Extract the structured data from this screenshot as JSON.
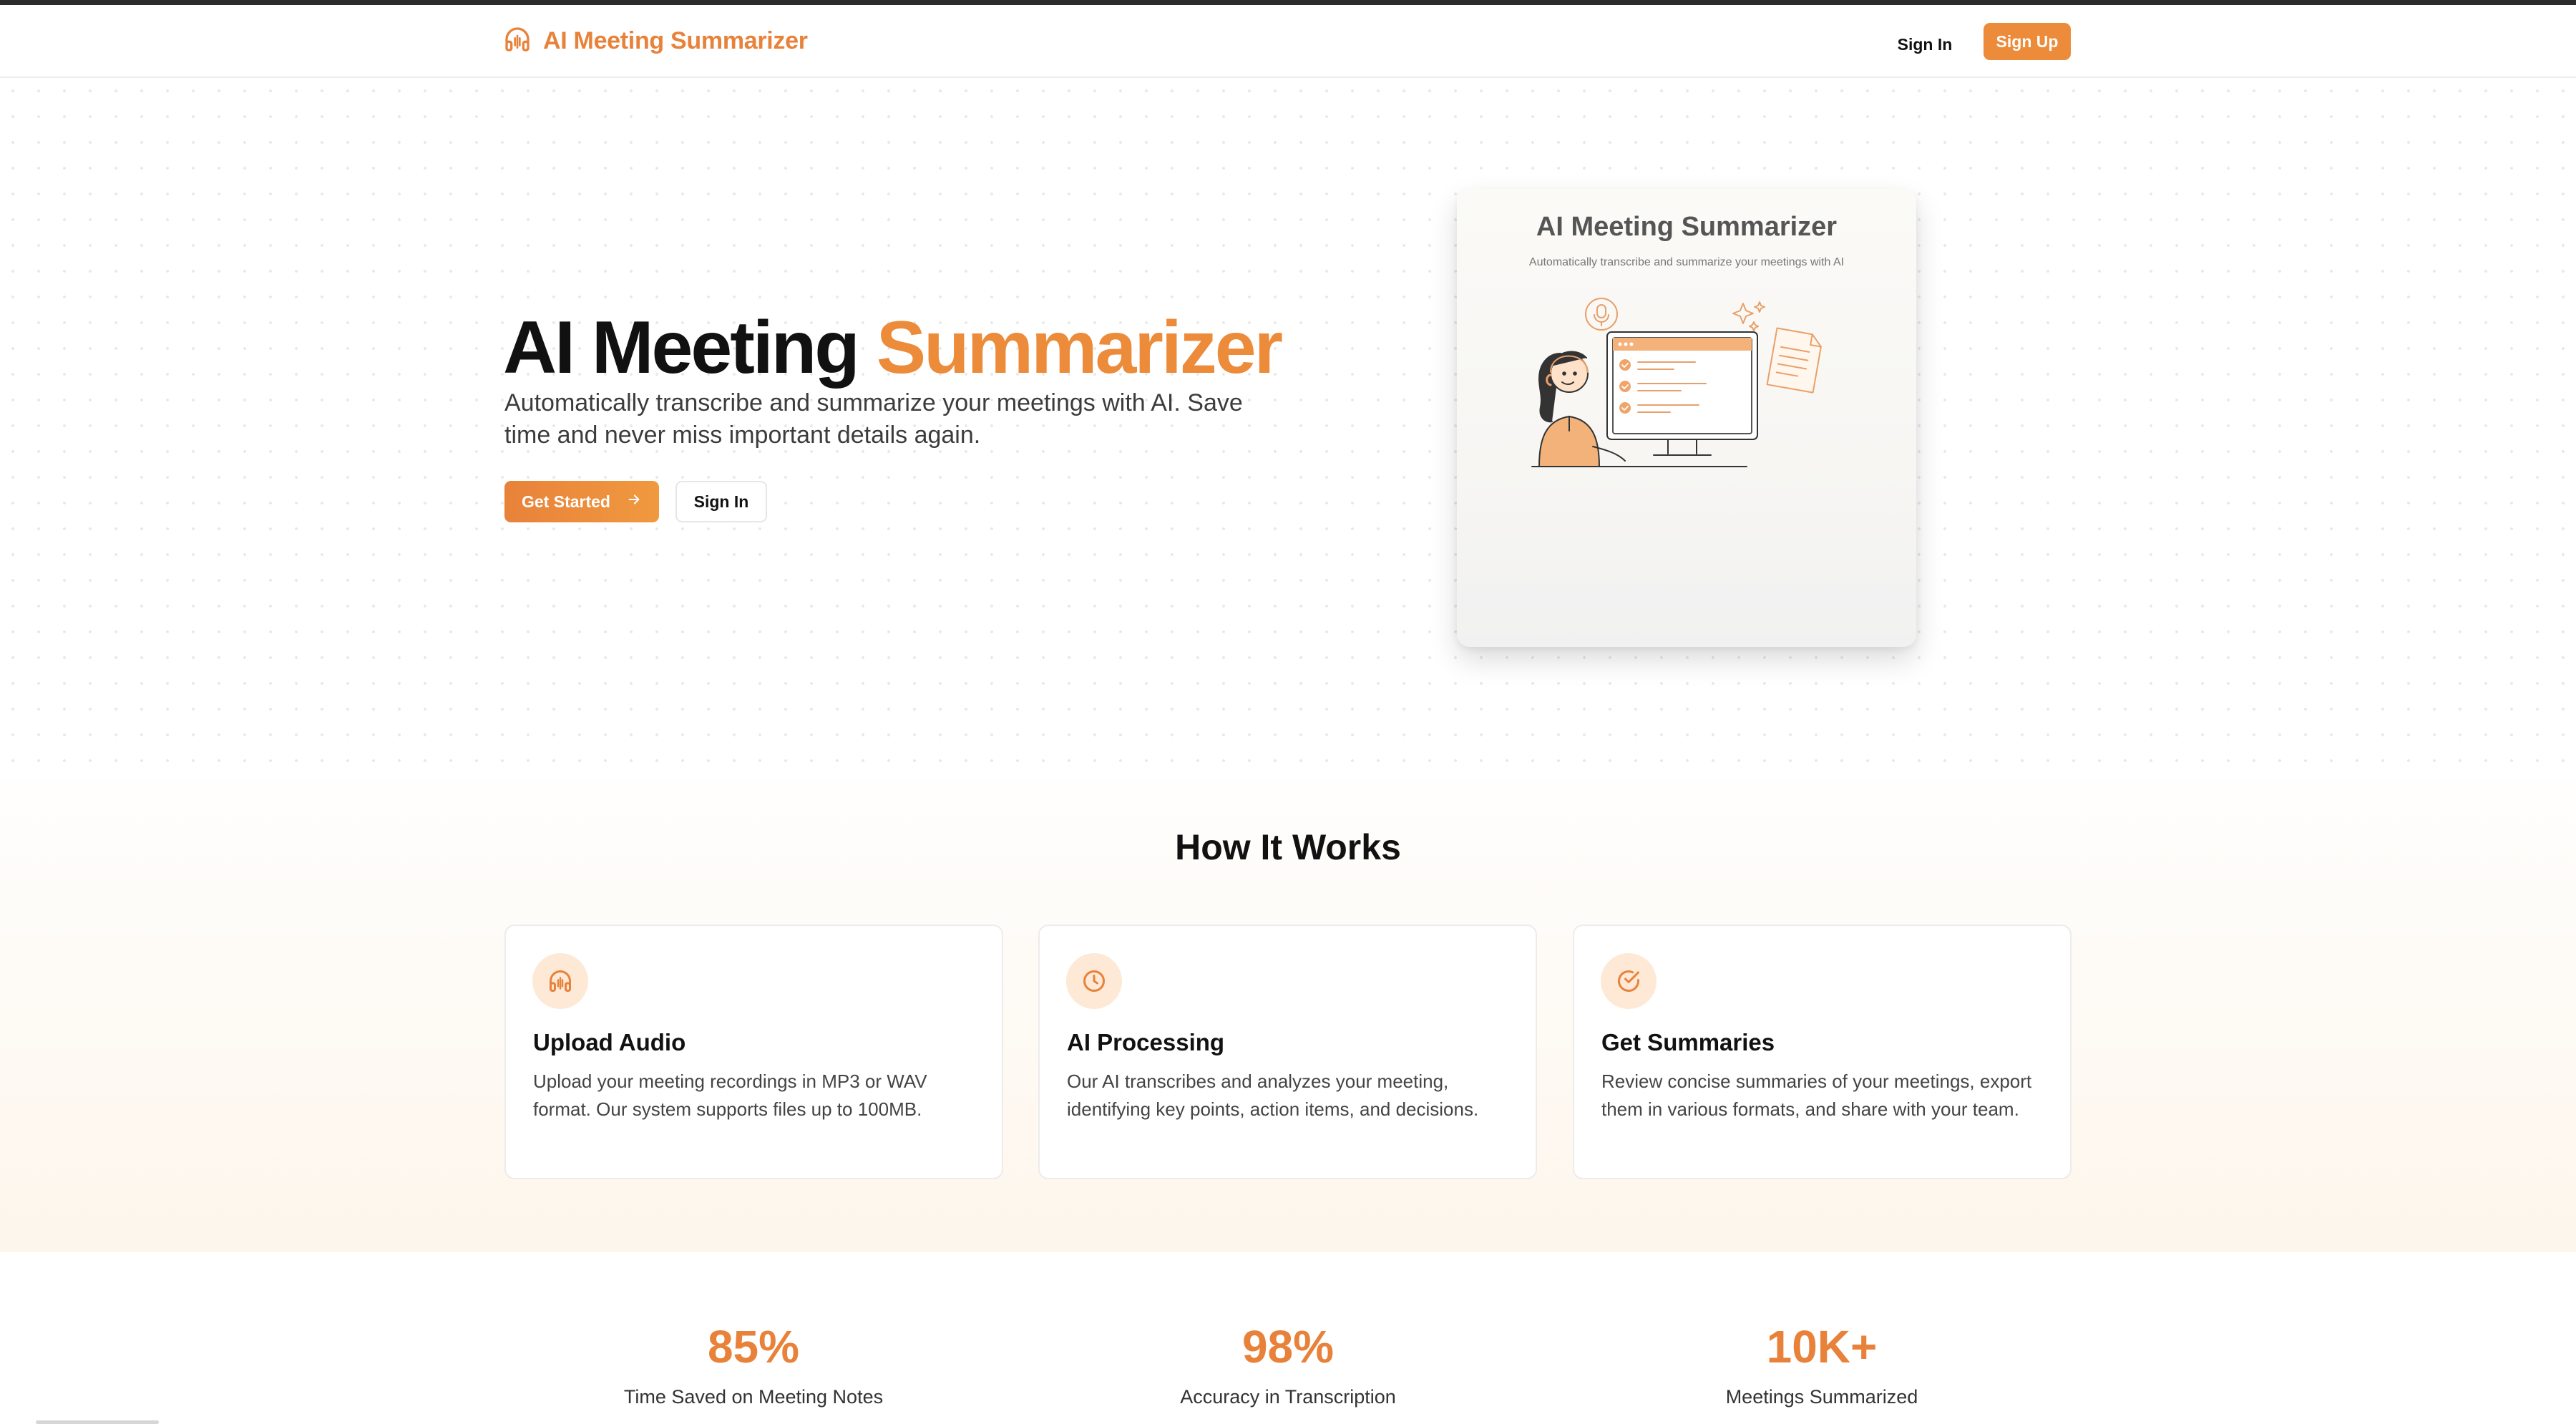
{
  "header": {
    "brand_icon": "headphones-icon",
    "brand_name": "AI Meeting Summarizer",
    "sign_in_label": "Sign In",
    "sign_up_label": "Sign Up"
  },
  "hero": {
    "title_part1": "AI Meeting",
    "title_part2": "Summarizer",
    "subtitle": "Automatically transcribe and summarize your meetings with AI. Save time and never miss important details again.",
    "get_started_label": "Get Started",
    "get_started_icon": "arrow-right-icon",
    "sign_in_label": "Sign In",
    "preview": {
      "title": "AI Meeting Summarizer",
      "subtitle": "Automatically transcribe and summarize your meetings with AI"
    }
  },
  "how_it_works": {
    "title": "How It Works",
    "cards": [
      {
        "icon": "headphones-icon",
        "title": "Upload Audio",
        "description": "Upload your meeting recordings in MP3 or WAV format. Our system supports files up to 100MB."
      },
      {
        "icon": "clock-icon",
        "title": "AI Processing",
        "description": "Our AI transcribes and analyzes your meeting, identifying key points, action items, and decisions."
      },
      {
        "icon": "check-circle-icon",
        "title": "Get Summaries",
        "description": "Review concise summaries of your meetings, export them in various formats, and share with your team."
      }
    ]
  },
  "stats": [
    {
      "value": "85%",
      "label": "Time Saved on Meeting Notes"
    },
    {
      "value": "98%",
      "label": "Accuracy in Transcription"
    },
    {
      "value": "10K+",
      "label": "Meetings Summarized"
    }
  ],
  "colors": {
    "accent": "#ec8b3a",
    "accent_light": "#fde9d6"
  }
}
